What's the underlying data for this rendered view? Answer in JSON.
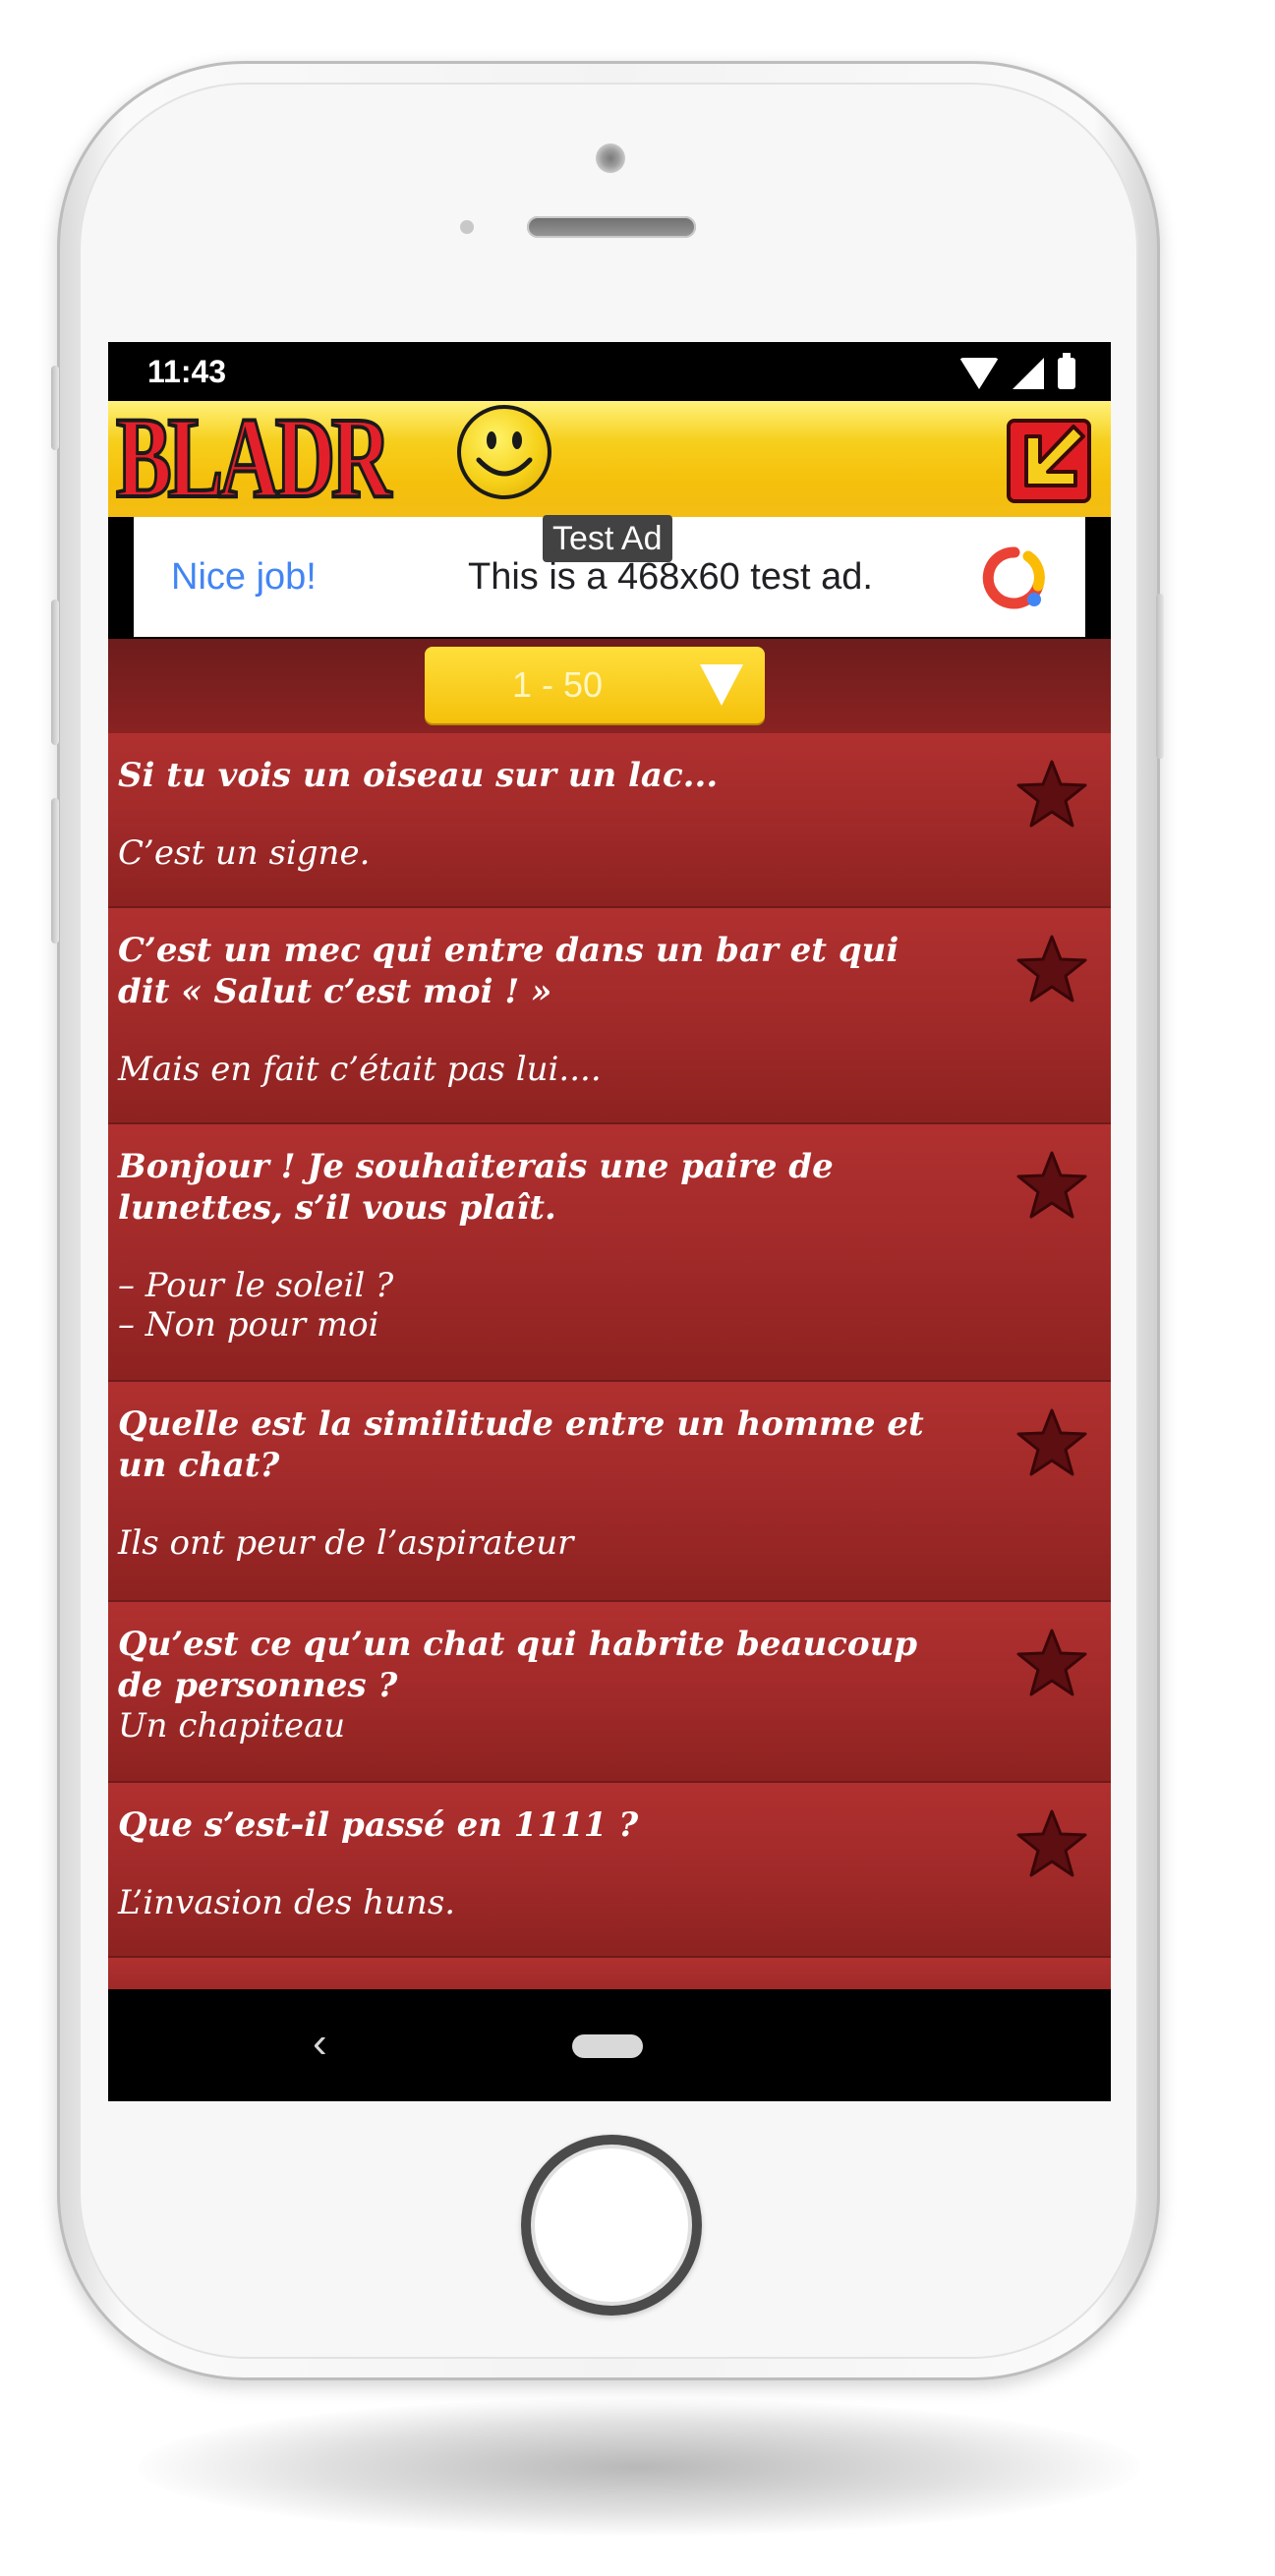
{
  "status_bar": {
    "time": "11:43"
  },
  "app": {
    "logo_text": "BLADR",
    "header_action_icon": "arrow-down-left-icon"
  },
  "ad": {
    "label": "Test Ad",
    "cta": "Nice job!",
    "text": "This is a 468x60 test ad."
  },
  "filter": {
    "range": "1 - 50"
  },
  "jokes": [
    {
      "question": "Si tu vois un oiseau sur un lac...",
      "answer": "C’est un signe."
    },
    {
      "question": "C’est un mec qui entre dans un bar et qui dit « Salut c’est moi ! »",
      "answer": "Mais en fait c’était pas lui...."
    },
    {
      "question": "Bonjour ! Je souhaiterais une paire de lunettes, s’il vous plaît.",
      "answer_line1": "– Pour le soleil ?",
      "answer_line2": "– Non pour moi"
    },
    {
      "question": "Quelle est la similitude entre un homme et un chat?",
      "answer": "Ils ont peur de l’aspirateur"
    },
    {
      "question": "Qu’est ce qu’un chat qui habrite beaucoup de personnes ?",
      "answer": "Un chapiteau"
    },
    {
      "question": "Que s’est-il passé en 1111 ?",
      "answer": "L’invasion des huns."
    }
  ],
  "colors": {
    "header_yellow": "#f5c00c",
    "row_red": "#a12a29",
    "star": "#5c0e10",
    "ad_blue": "#4285f4"
  }
}
